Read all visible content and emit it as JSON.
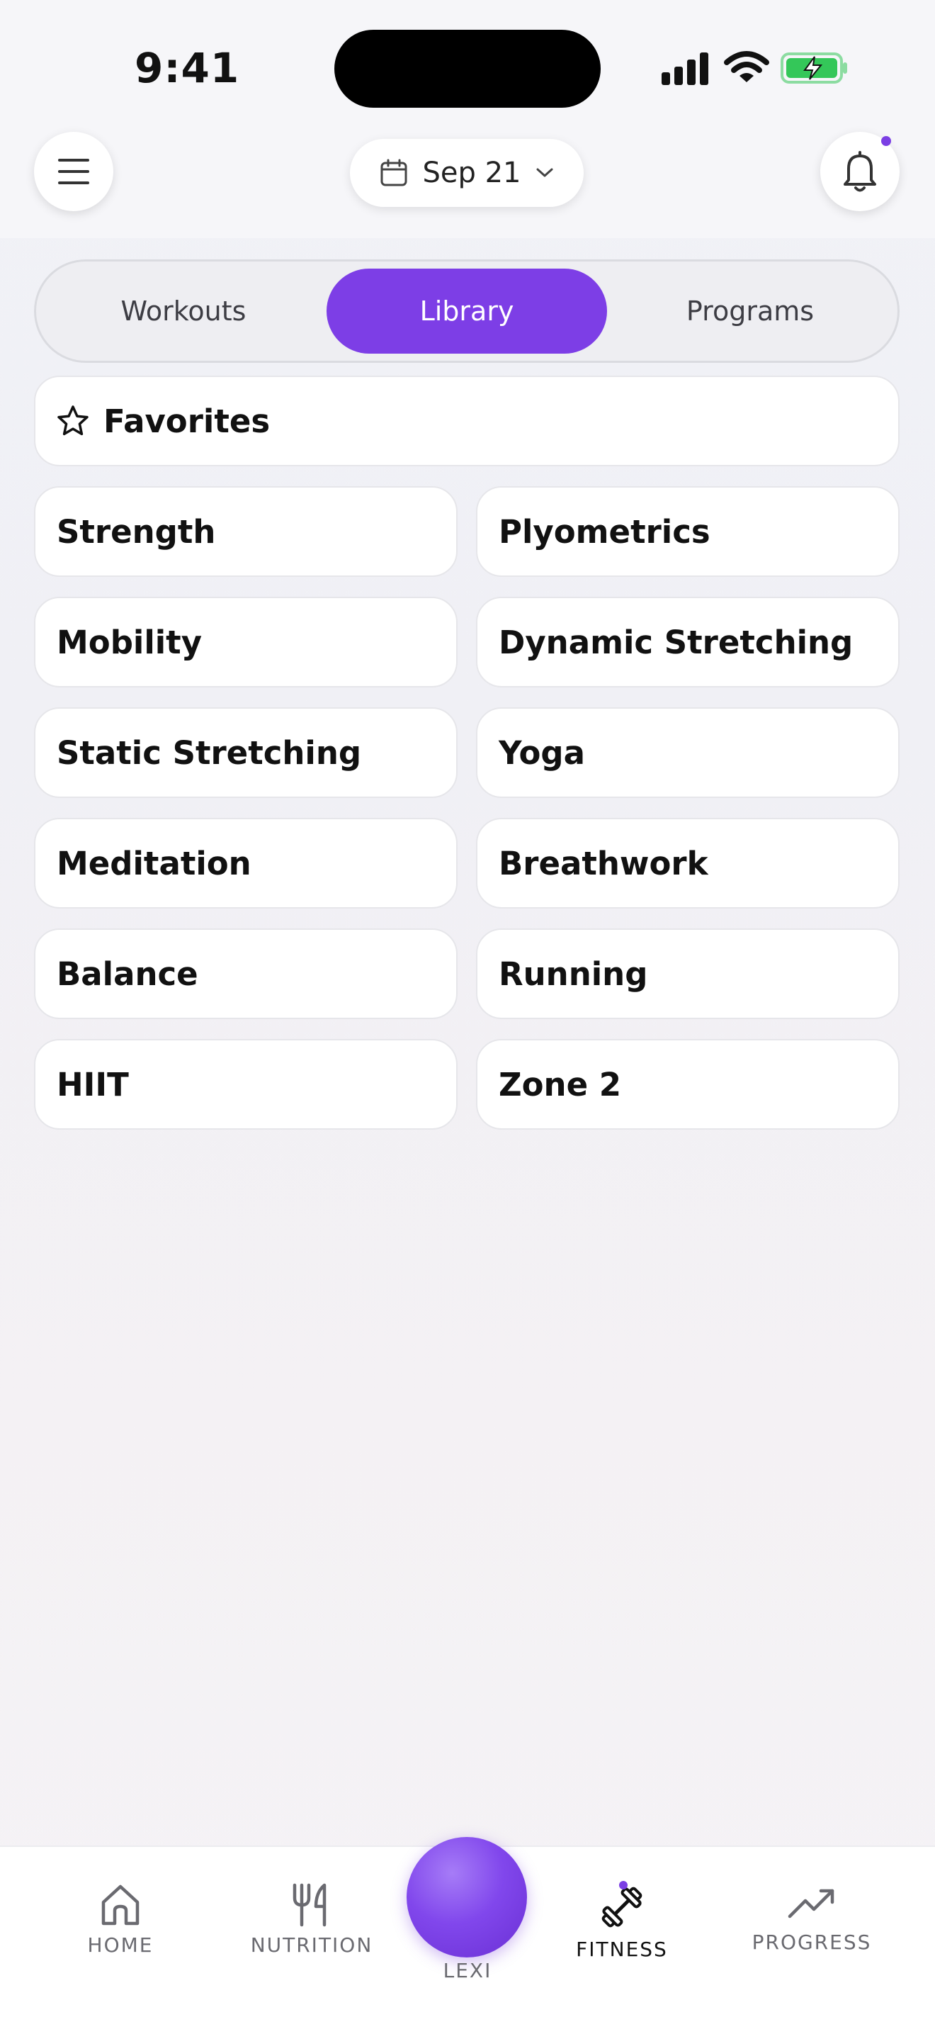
{
  "status_bar": {
    "time": "9:41"
  },
  "header": {
    "date_label": "Sep 21"
  },
  "tabs": [
    {
      "label": "Workouts"
    },
    {
      "label": "Library",
      "active": true
    },
    {
      "label": "Programs"
    }
  ],
  "favorites": {
    "label": "Favorites"
  },
  "categories": [
    "Strength",
    "Plyometrics",
    "Mobility",
    "Dynamic Stretching",
    "Static Stretching",
    "Yoga",
    "Meditation",
    "Breathwork",
    "Balance",
    "Running",
    "HIIT",
    "Zone 2"
  ],
  "bottom_nav": {
    "home": "HOME",
    "nutrition": "NUTRITION",
    "lexi": "LEXI",
    "fitness": "FITNESS",
    "progress": "PROGRESS"
  },
  "colors": {
    "accent": "#7d3ee6",
    "battery": "#34c759"
  },
  "icons": [
    "menu-icon",
    "calendar-icon",
    "chevron-down-icon",
    "bell-icon",
    "star-icon",
    "home-icon",
    "fork-knife-icon",
    "dumbbell-icon",
    "trending-up-icon"
  ]
}
